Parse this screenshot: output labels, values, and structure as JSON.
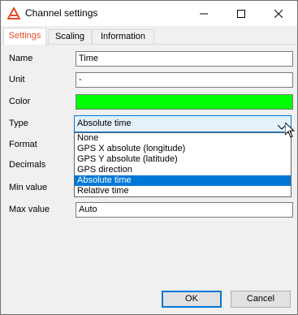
{
  "window": {
    "title": "Channel settings",
    "icon": "app-logo-icon",
    "controls": {
      "minimize": "minimize-icon",
      "maximize": "maximize-icon",
      "close": "close-icon"
    }
  },
  "tabs": [
    {
      "label": "Settings",
      "active": true
    },
    {
      "label": "Scaling",
      "active": false
    },
    {
      "label": "Information",
      "active": false
    }
  ],
  "form": {
    "name_label": "Name",
    "name_value": "Time",
    "unit_label": "Unit",
    "unit_value": "-",
    "color_label": "Color",
    "color_value": "#00ff00",
    "type_label": "Type",
    "type_value": "Absolute time",
    "format_label": "Format",
    "decimals_label": "Decimals",
    "min_label": "Min value",
    "max_label": "Max value",
    "max_value": "Auto"
  },
  "type_options": [
    "None",
    "GPS X absolute (longitude)",
    "GPS Y absolute (latitude)",
    "GPS direction",
    "Absolute time",
    "Relative time"
  ],
  "buttons": {
    "ok": "OK",
    "cancel": "Cancel"
  },
  "colors": {
    "accent": "#e44d26",
    "selection": "#0078d7",
    "color_swatch": "#00ff00"
  }
}
